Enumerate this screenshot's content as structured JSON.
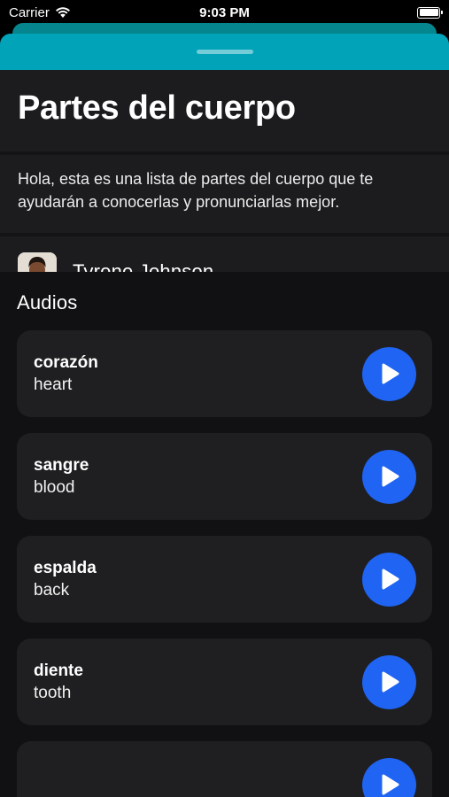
{
  "status_bar": {
    "carrier": "Carrier",
    "time": "9:03 PM",
    "battery_level": 1.0
  },
  "header": {
    "title": "Partes del cuerpo"
  },
  "description": "Hola, esta es una lista de partes del cuerpo que te ayudarán a conocerlas y pronunciarlas mejor.",
  "author": {
    "name": "Tyrone Johnson"
  },
  "audios": {
    "section_title": "Audios",
    "items": [
      {
        "word": "corazón",
        "translation": "heart",
        "icon": "play-icon"
      },
      {
        "word": "sangre",
        "translation": "blood",
        "icon": "play-icon"
      },
      {
        "word": "espalda",
        "translation": "back",
        "icon": "play-icon"
      },
      {
        "word": "diente",
        "translation": "tooth",
        "icon": "play-icon"
      },
      {
        "word": "",
        "translation": "",
        "icon": "play-icon"
      }
    ]
  },
  "colors": {
    "accent": "#1f64f2",
    "sheet_header": "#00a3b8",
    "background": "#1c1c1e"
  }
}
